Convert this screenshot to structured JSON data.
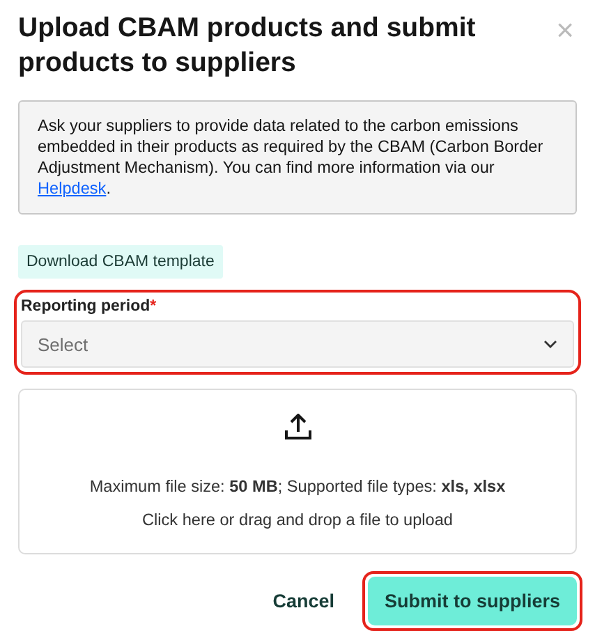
{
  "dialog": {
    "title": "Upload CBAM products and submit products to suppliers",
    "close": "×"
  },
  "info": {
    "text": "Ask your suppliers to provide data related to the carbon emissions embedded in their products as required by the CBAM (Carbon Border Adjustment Mechanism). You can find more information via our ",
    "link": "Helpdesk",
    "end": "."
  },
  "download_button": "Download CBAM template",
  "reporting_period": {
    "label": "Reporting period",
    "required_mark": "*",
    "placeholder": "Select",
    "highlighted": true
  },
  "upload": {
    "limits": "Maximum file size: **50 MB**; Supported file types: **xls, xlsx**",
    "hint": "Click here or drag and drop a file to upload"
  },
  "buttons": [
    {
      "label": "Cancel",
      "kind": "text",
      "highlighted": false
    },
    {
      "label": "Submit to suppliers",
      "kind": "primary",
      "highlighted": true
    }
  ]
}
